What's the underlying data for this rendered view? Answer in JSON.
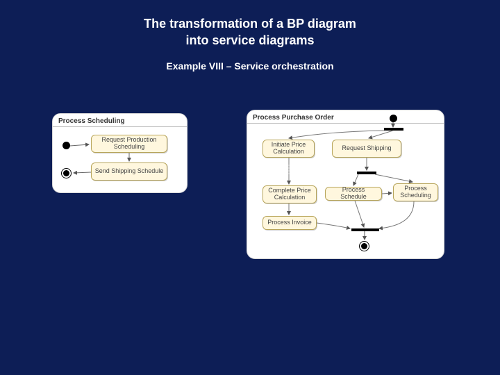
{
  "title_line1": "The transformation of a BP diagram",
  "title_line2": "into service diagrams",
  "subtitle": "Example VIII – Service orchestration",
  "left_panel": {
    "title": "Process Scheduling",
    "nodes": {
      "a": "Request Production Scheduling",
      "b": "Send Shipping Schedule"
    }
  },
  "right_panel": {
    "title": "Process Purchase Order",
    "nodes": {
      "n1": "Initiate Price Calculation",
      "n2": "Request Shipping",
      "n3": "Complete Price Calculation",
      "n4": "Process Schedule",
      "n5": "Process Scheduling",
      "n6": "Process Invoice"
    }
  }
}
